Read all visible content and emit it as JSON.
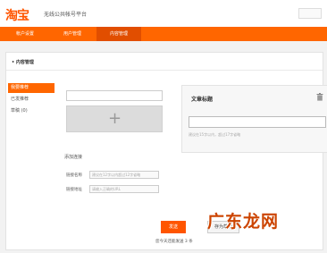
{
  "header": {
    "logo_text": "淘宝",
    "platform_title": "无线公共帐号平台"
  },
  "nav": {
    "tabs": [
      {
        "label": "帐户设置"
      },
      {
        "label": "用户管理"
      },
      {
        "label": "内容管理"
      }
    ]
  },
  "panel": {
    "title": "• 内容管理"
  },
  "sidebar": {
    "items": [
      {
        "label": "我要推荐"
      },
      {
        "label": "已发推荐"
      },
      {
        "label": "草稿 (0)"
      }
    ]
  },
  "editor": {
    "upload_plus": "+",
    "article_title_label": "文章标题",
    "article_hint": "建议在15字以内，超过17字省略",
    "link_section_title": "添加连接",
    "link_name_label": "链接名称",
    "link_name_placeholder": "建议在12字以内超过12字省略",
    "link_url_label": "链接地址",
    "link_url_placeholder": "请输入正确的URL"
  },
  "actions": {
    "publish_label": "发送",
    "preview_label": "存为草稿",
    "remaining_text": "您今天还能发送 3 条"
  },
  "watermark": {
    "text": "广东龙网"
  },
  "colors": {
    "accent": "#ff6600",
    "accent_dark": "#e14e00",
    "logo": "#ff5500"
  }
}
